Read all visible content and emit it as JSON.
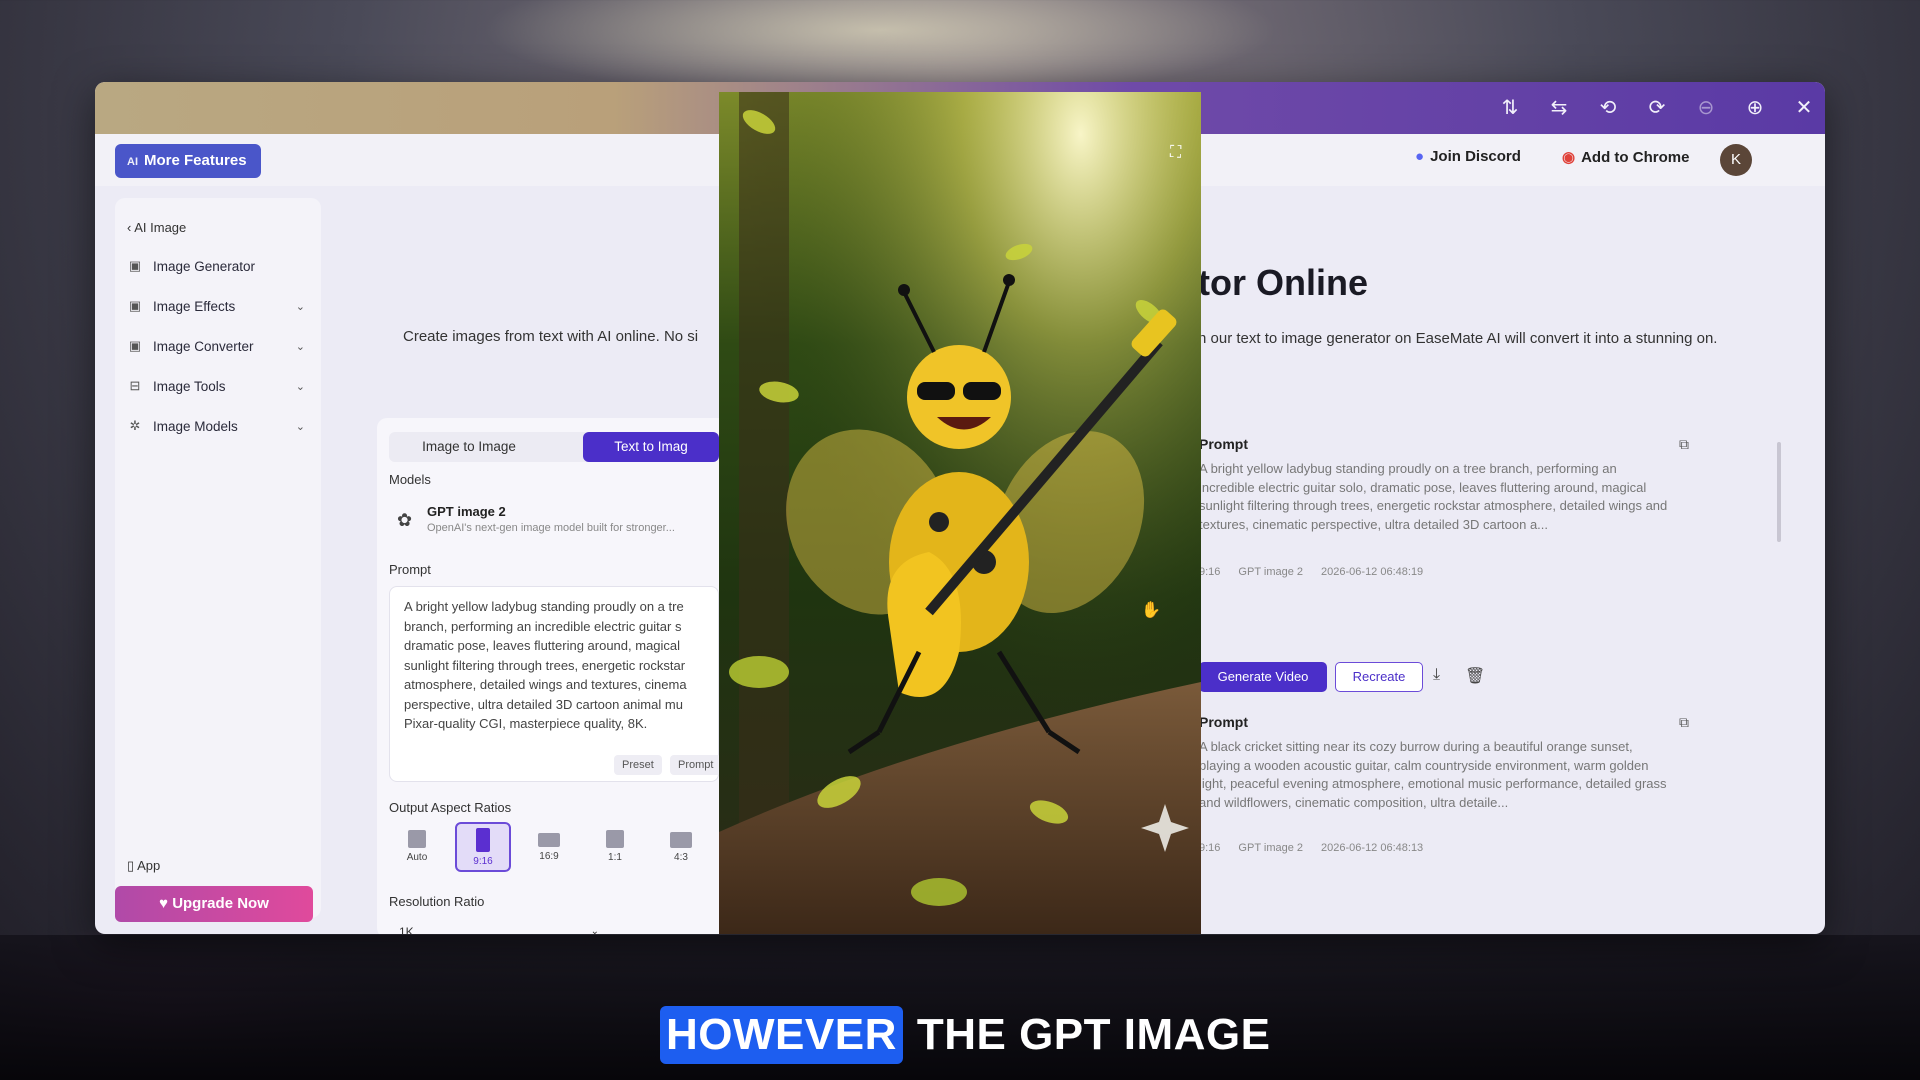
{
  "viewer": {
    "toolbar_icons": [
      "sort-icon",
      "swap-icon",
      "rotate-left-icon",
      "rotate-right-icon",
      "zoom-out-icon",
      "zoom-in-icon",
      "close-icon"
    ]
  },
  "header": {
    "more_features": "More Features",
    "join_discord": "Join Discord",
    "add_to_chrome": "Add to Chrome",
    "avatar_initial": "K"
  },
  "sidebar": {
    "back_label": "AI Image",
    "items": [
      {
        "label": "Image Generator"
      },
      {
        "label": "Image Effects"
      },
      {
        "label": "Image Converter"
      },
      {
        "label": "Image Tools"
      },
      {
        "label": "Image Models"
      }
    ],
    "app_label": "App",
    "upgrade_label": "Upgrade Now"
  },
  "main": {
    "title_partial": "tor Online",
    "subtitle_left": "Create images from text with AI online. No si",
    "subtitle_right": "n our text to image generator on EaseMate AI will convert it into a stunning on."
  },
  "generator": {
    "tabs": [
      "Image to Image",
      "Text to Imag"
    ],
    "models_label": "Models",
    "model_name": "GPT image 2",
    "model_desc": "OpenAI's next-gen image model built for stronger...",
    "prompt_label": "Prompt",
    "prompt_text": "A bright yellow ladybug standing proudly on a tre branch, performing an incredible electric guitar s dramatic pose, leaves fluttering around, magical sunlight filtering through trees, energetic rockstar atmosphere, detailed wings and textures, cinema perspective, ultra detailed 3D cartoon animal mu Pixar-quality CGI, masterpiece quality, 8K.",
    "chip_preset": "Preset",
    "chip_prompt": "Prompt",
    "ratios_label": "Output Aspect Ratios",
    "ratios": [
      "Auto",
      "9:16",
      "16:9",
      "1:1",
      "4:3"
    ],
    "selected_ratio": "9:16",
    "resolution_label": "Resolution Ratio",
    "resolution_value": "1K"
  },
  "history": [
    {
      "title": "Prompt",
      "text": "A bright yellow ladybug standing proudly on a tree branch, performing an incredible electric guitar solo, dramatic pose, leaves fluttering around, magical sunlight filtering through trees, energetic rockstar atmosphere, detailed wings and textures, cinematic perspective, ultra detailed 3D cartoon a...",
      "ratio": "9:16",
      "model": "GPT image 2",
      "timestamp": "2026-06-12 06:48:19"
    },
    {
      "title": "Prompt",
      "text": "A black cricket sitting near its cozy burrow during a beautiful orange sunset, playing a wooden acoustic guitar, calm countryside environment, warm golden light, peaceful evening atmosphere, emotional music performance, detailed grass and wildflowers, cinematic composition, ultra detaile...",
      "ratio": "9:16",
      "model": "GPT image 2",
      "timestamp": "2026-06-12 06:48:13"
    }
  ],
  "actions": {
    "generate_video": "Generate Video",
    "recreate": "Recreate"
  },
  "caption": {
    "highlight": "HOWEVER",
    "rest": "THE GPT IMAGE"
  },
  "colors": {
    "accent": "#4b2fc9",
    "upgrade": "#d04aa0",
    "caption_highlight": "#1d5ef0"
  }
}
